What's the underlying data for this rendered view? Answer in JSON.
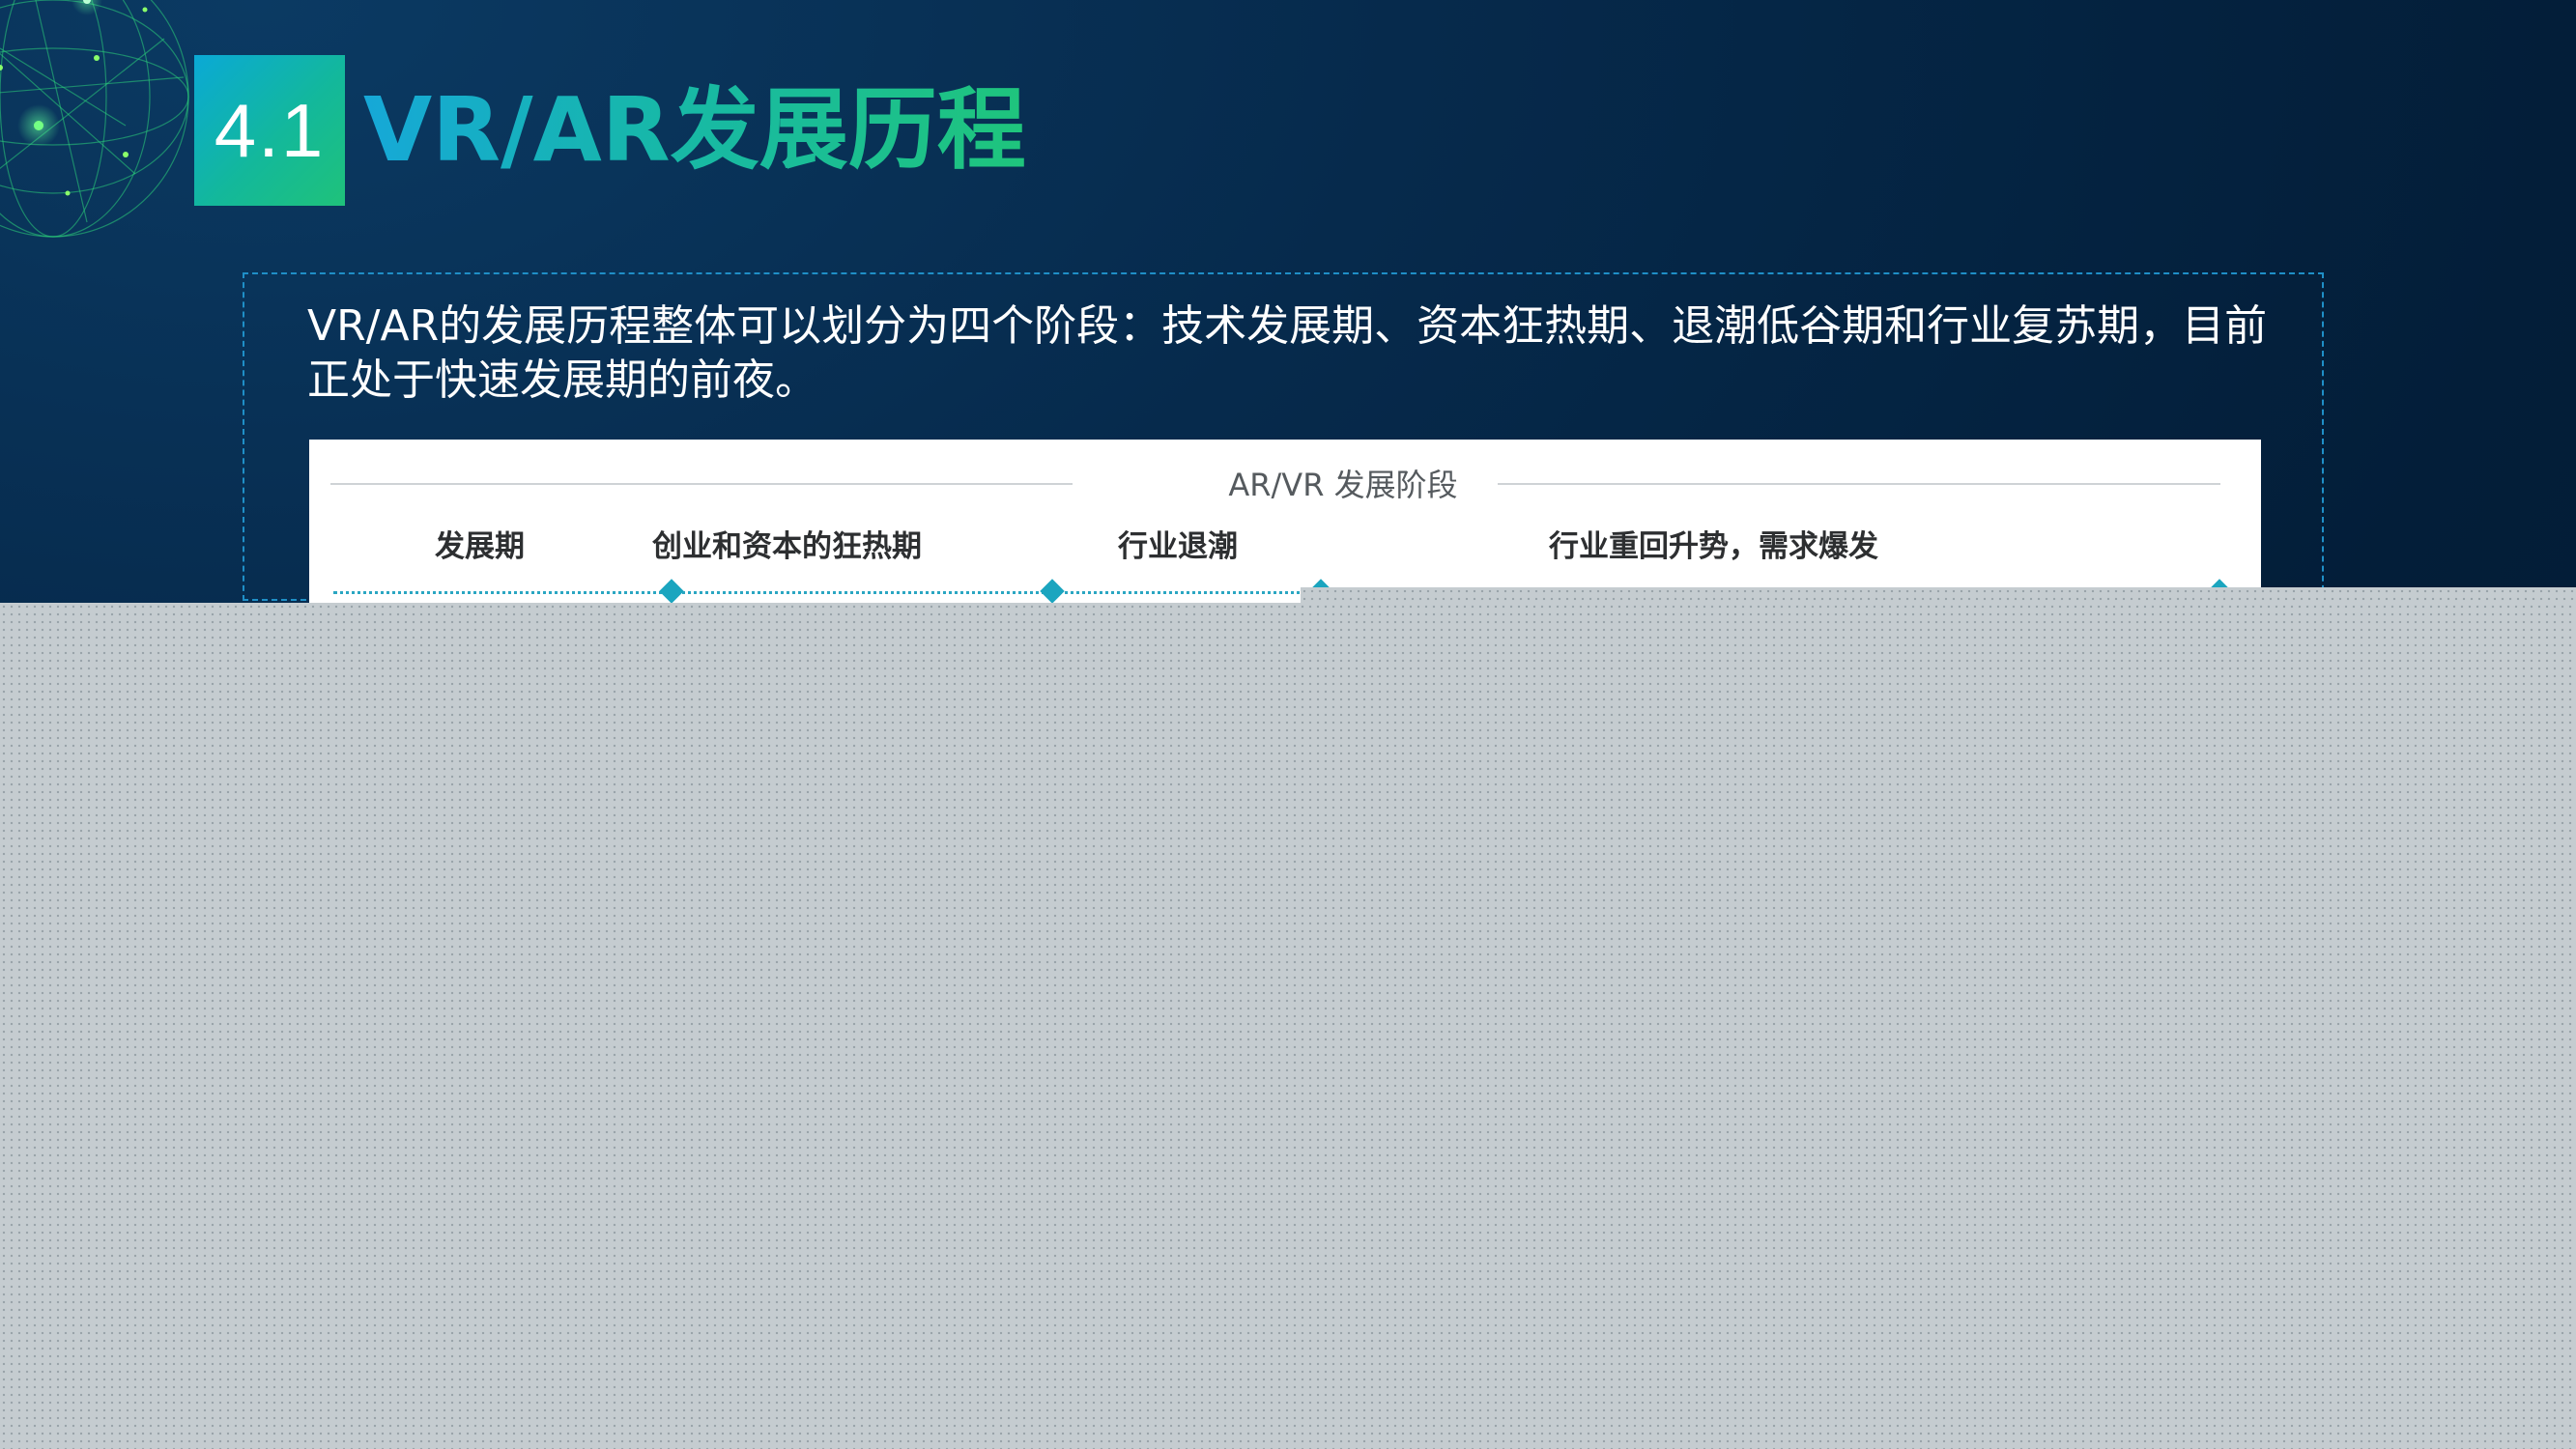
{
  "section": {
    "number": "4.1",
    "title": "VR/AR发展历程"
  },
  "intro": {
    "text": "VR/AR的发展历程整体可以划分为四个阶段：技术发展期、资本狂热期、退潮低谷期和行业复苏期，目前正处于快速发展期的前夜。"
  },
  "chart": {
    "title": "AR/VR  发展阶段",
    "phases": [
      {
        "label": "发展期"
      },
      {
        "label": "创业和资本的狂热期"
      },
      {
        "label": "行业退潮"
      },
      {
        "label": "行业重回升势，需求爆发"
      }
    ]
  },
  "colors": {
    "accent_teal": "#13b89b",
    "accent_blue": "#0aa9d6",
    "background": "#031e39",
    "timeline": "#1ba5bf"
  }
}
